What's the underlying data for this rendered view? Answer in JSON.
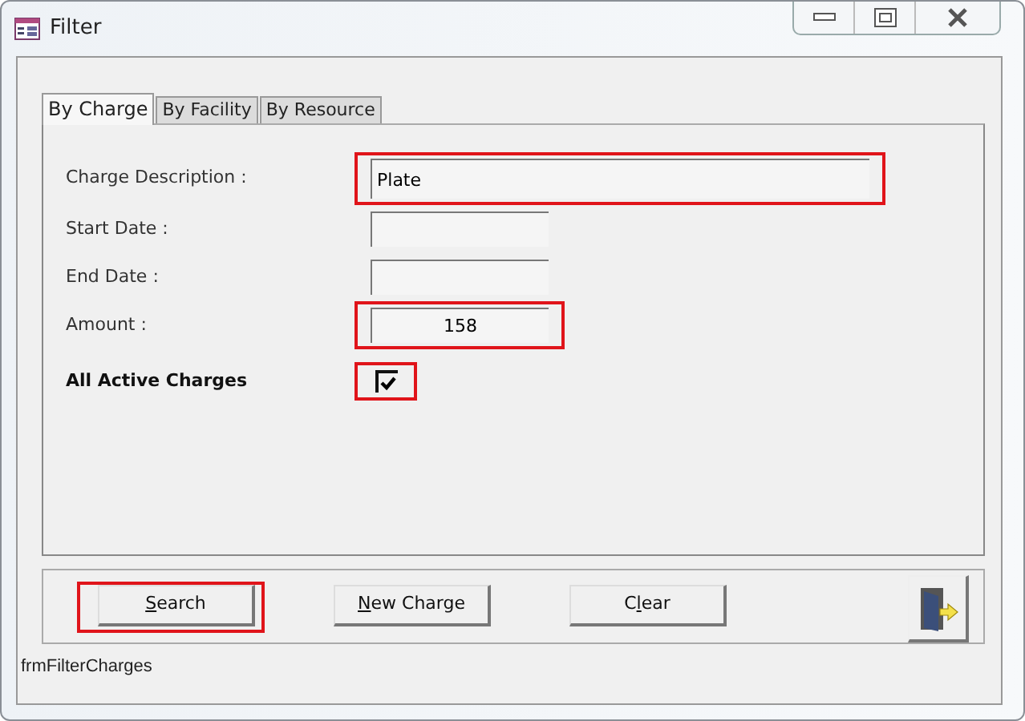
{
  "window": {
    "title": "Filter"
  },
  "tabs": [
    {
      "label": "By Charge",
      "selected": true
    },
    {
      "label": "By Facility",
      "selected": false
    },
    {
      "label": "By Resource",
      "selected": false
    }
  ],
  "fields": [
    {
      "kind": "wide_text",
      "label": "Charge Description :",
      "value": "Plate",
      "highlighted": true
    },
    {
      "kind": "short_text",
      "label": "Start Date :",
      "highlighted": false
    },
    {
      "kind": "short_text",
      "label": "End Date :",
      "highlighted": false
    },
    {
      "kind": "amount",
      "label": "Amount :",
      "value": "158",
      "highlighted": true
    },
    {
      "kind": "checkbox",
      "label": "All Active Charges",
      "checked": true,
      "highlighted": true
    }
  ],
  "buttons": [
    {
      "key": "S",
      "after": "earch",
      "highlighted": true
    },
    {
      "key": "N",
      "after": "ew Charge",
      "highlighted": false
    },
    {
      "before": "C",
      "key": "l",
      "after": "ear",
      "highlighted": false
    }
  ],
  "status_text": "frmFilterCharges"
}
